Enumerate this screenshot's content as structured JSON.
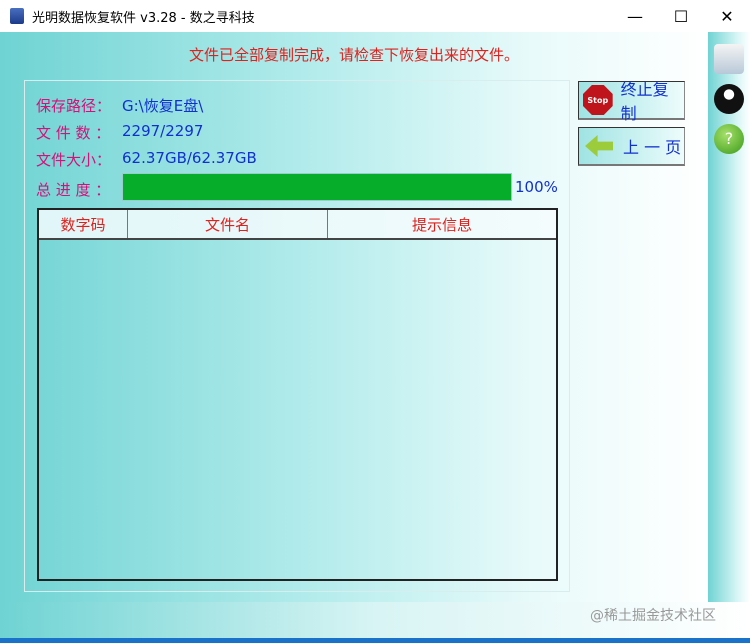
{
  "window": {
    "title": "光明数据恢复软件 v3.28 - 数之寻科技",
    "minimize": "—",
    "maximize": "☐",
    "close": "✕"
  },
  "message": "文件已全部复制完成，请检查下恢复出来的文件。",
  "info": {
    "save_path_label": "保存路径：",
    "save_path": "G:\\恢复E盘\\",
    "file_count_label": "文 件 数 ：",
    "file_count": "2297/2297",
    "file_size_label": "文件大小：",
    "file_size": "62.37GB/62.37GB",
    "progress_label": "总 进 度 ：",
    "progress_percent": 100,
    "progress_text": "100%"
  },
  "table": {
    "columns": [
      "数字码",
      "文件名",
      "提示信息"
    ],
    "rows": []
  },
  "buttons": {
    "stop_icon": "Stop",
    "stop": "终止复制",
    "back": "上 一 页"
  },
  "side_icons": [
    "settings-icon",
    "qq-icon",
    "help-icon"
  ],
  "watermark": "@稀土掘金技术社区"
}
